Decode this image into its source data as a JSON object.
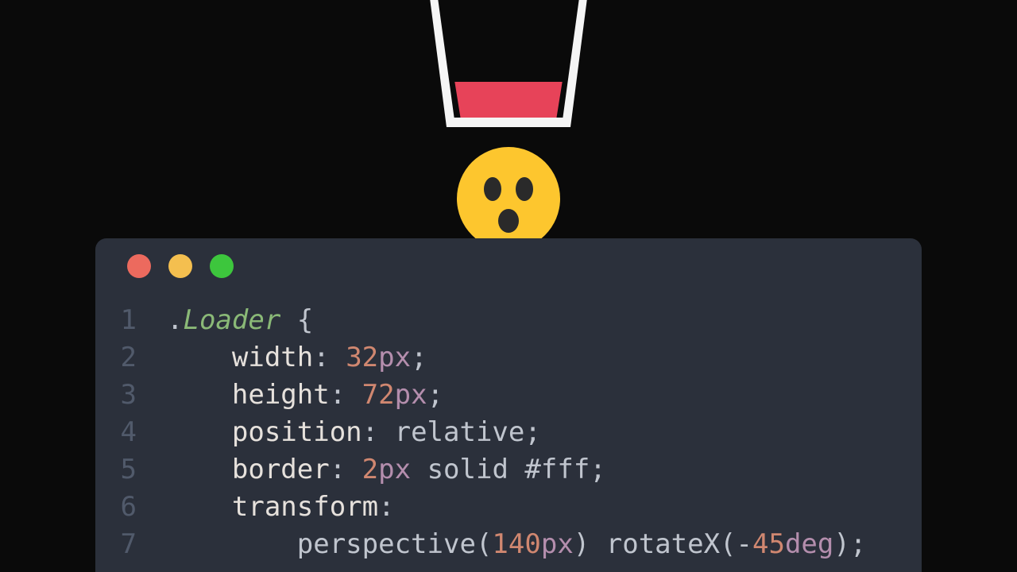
{
  "cup": {
    "fill_color": "#e74359",
    "border_color": "#f5f5f5"
  },
  "emoji": {
    "name": "surprised-face",
    "bg": "#fdc62e"
  },
  "editor": {
    "window_dots": [
      "red",
      "yellow",
      "green"
    ],
    "code_lines": [
      {
        "n": "1",
        "tokens": [
          {
            "t": ".",
            "c": "tok-punc"
          },
          {
            "t": "Loader",
            "c": "tok-selector"
          },
          {
            "t": " {",
            "c": "tok-punc"
          }
        ]
      },
      {
        "n": "2",
        "indent": "    ",
        "tokens": [
          {
            "t": "width",
            "c": "tok-prop"
          },
          {
            "t": ": ",
            "c": "tok-punc"
          },
          {
            "t": "32",
            "c": "tok-num"
          },
          {
            "t": "px",
            "c": "tok-unit"
          },
          {
            "t": ";",
            "c": "tok-punc"
          }
        ]
      },
      {
        "n": "3",
        "indent": "    ",
        "tokens": [
          {
            "t": "height",
            "c": "tok-prop"
          },
          {
            "t": ": ",
            "c": "tok-punc"
          },
          {
            "t": "72",
            "c": "tok-num"
          },
          {
            "t": "px",
            "c": "tok-unit"
          },
          {
            "t": ";",
            "c": "tok-punc"
          }
        ]
      },
      {
        "n": "4",
        "indent": "    ",
        "tokens": [
          {
            "t": "position",
            "c": "tok-prop"
          },
          {
            "t": ": ",
            "c": "tok-punc"
          },
          {
            "t": "relative",
            "c": "tok-keyword"
          },
          {
            "t": ";",
            "c": "tok-punc"
          }
        ]
      },
      {
        "n": "5",
        "indent": "    ",
        "tokens": [
          {
            "t": "border",
            "c": "tok-prop"
          },
          {
            "t": ": ",
            "c": "tok-punc"
          },
          {
            "t": "2",
            "c": "tok-num"
          },
          {
            "t": "px",
            "c": "tok-unit"
          },
          {
            "t": " solid ",
            "c": "tok-keyword"
          },
          {
            "t": "#fff",
            "c": "tok-str"
          },
          {
            "t": ";",
            "c": "tok-punc"
          }
        ]
      },
      {
        "n": "6",
        "indent": "    ",
        "tokens": [
          {
            "t": "transform",
            "c": "tok-prop"
          },
          {
            "t": ":",
            "c": "tok-punc"
          }
        ]
      },
      {
        "n": "7",
        "indent": "        ",
        "tokens": [
          {
            "t": "perspective",
            "c": "tok-func"
          },
          {
            "t": "(",
            "c": "tok-punc"
          },
          {
            "t": "140",
            "c": "tok-num"
          },
          {
            "t": "px",
            "c": "tok-unit"
          },
          {
            "t": ") ",
            "c": "tok-punc"
          },
          {
            "t": "rotateX",
            "c": "tok-func"
          },
          {
            "t": "(-",
            "c": "tok-punc"
          },
          {
            "t": "45",
            "c": "tok-num"
          },
          {
            "t": "deg",
            "c": "tok-unit"
          },
          {
            "t": ");",
            "c": "tok-punc"
          }
        ]
      }
    ]
  }
}
